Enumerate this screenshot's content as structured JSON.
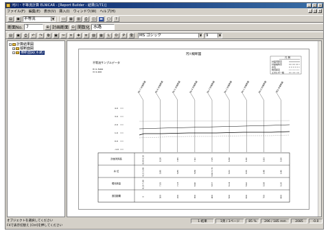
{
  "window": {
    "title": "河川・不等流計算 ELNICAR - [Report Builder - 結果(1/71)]",
    "controls": [
      "_",
      "□",
      "×"
    ],
    "mdi_controls": [
      "_",
      "□",
      "×"
    ]
  },
  "menu": [
    "ファイル(F)",
    "編集(E)",
    "表示(V)",
    "挿入(I)",
    "ウィンドウ(W)",
    "ヘルプ(H)"
  ],
  "toolbar1": {
    "mode_value": "不等流"
  },
  "toolbar2": {
    "section_label": "断面No.",
    "section_value": "7",
    "plan_label": "計画断面",
    "file_label": "関数化",
    "water_label": "水路"
  },
  "toolbar3": {
    "text_buttons": [
      "L",
      "O",
      "P",
      "復"
    ],
    "font_value": "MS ゴシック",
    "size_value": "9"
  },
  "tree": {
    "items": [
      {
        "label": "計算結果図",
        "indent": 0,
        "expander": "−"
      },
      {
        "label": "縦断面図",
        "indent": 1,
        "expander": "+"
      },
      {
        "label": "横断面図(水路)",
        "indent": 1,
        "expander": "−",
        "selected": true
      }
    ]
  },
  "report": {
    "title": "河川縦断図",
    "subtitle": "不等流サンプルデータ",
    "scale_h": "H=1:5000",
    "scale_v": "V=1:200",
    "legend_title": "凡  例",
    "legend": [
      "計画河床高",
      "計画堤防高",
      "水位",
      "現河床高",
      "エネルギー線"
    ],
    "section_headers": [
      "No.7 計画断面",
      "No.6 計画断面",
      "No.5 計画断面",
      "No.4 計画断面",
      "No.3 計画断面",
      "No.2 計画断面",
      "No.1 計画断面",
      "No.0 計画断面",
      "河口 計画断面"
    ],
    "elev_ticks": [
      "4.0",
      "3.0",
      "2.0",
      "1.0",
      "0.0",
      "-1.0"
    ],
    "table_rows": [
      {
        "label": "計画河床高",
        "cells": [
          "8.65 8.15",
          "8.28",
          "7.85",
          "7.42",
          "7.05",
          "6.68",
          "6.30",
          "5.93",
          "5.56"
        ]
      },
      {
        "label": "水 位",
        "cells": [
          "4.22 3.90",
          "3.86",
          "3.85",
          "3.84",
          "3.82 3.70",
          "3.62",
          "3.55",
          "3.48",
          "3.40"
        ]
      },
      {
        "label": "現河床高",
        "cells": [
          "8.20 7.90",
          "7.55",
          "7.23",
          "6.90",
          "6.57",
          "6.24",
          "5.92",
          "5.58",
          "5.26"
        ]
      },
      {
        "label": "追加距離",
        "cells": [
          "0",
          "100",
          "200",
          "300",
          "400",
          "500",
          "600",
          "700",
          "800"
        ]
      }
    ]
  },
  "status": {
    "line1": "オブジェクトを選択してください",
    "line2": "F4で表示切替え [Ctrl]を押してください",
    "cells": [
      "1-結果",
      "1頁 / 1ページ",
      "85 %",
      "296 / 185 mm",
      "2085",
      "-0.0"
    ]
  }
}
